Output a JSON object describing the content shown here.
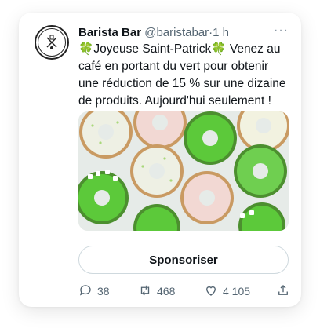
{
  "tweet": {
    "account_name": "Barista Bar",
    "handle": "@baristabar",
    "separator": "·",
    "time": "1 h",
    "more_label": "···",
    "text_part1": "Joyeuse Saint-Patrick",
    "text_part2": " Venez au café en portant du vert pour obtenir une réduction de 15 % sur une dizaine de produits. Aujourd'hui seulement !",
    "emoji": "🍀",
    "sponsor_label": "Sponsoriser"
  },
  "actions": {
    "replies": "38",
    "retweets": "468",
    "likes": "4 105"
  },
  "icons": [
    "logo-icon",
    "more-icon",
    "reply-icon",
    "retweet-icon",
    "like-icon",
    "share-icon"
  ],
  "colors": {
    "text": "#0f1419",
    "muted": "#536471",
    "clover": "#3fa34d",
    "green_icing": "#5cc93a",
    "pink_icing": "#f2d8d3"
  }
}
